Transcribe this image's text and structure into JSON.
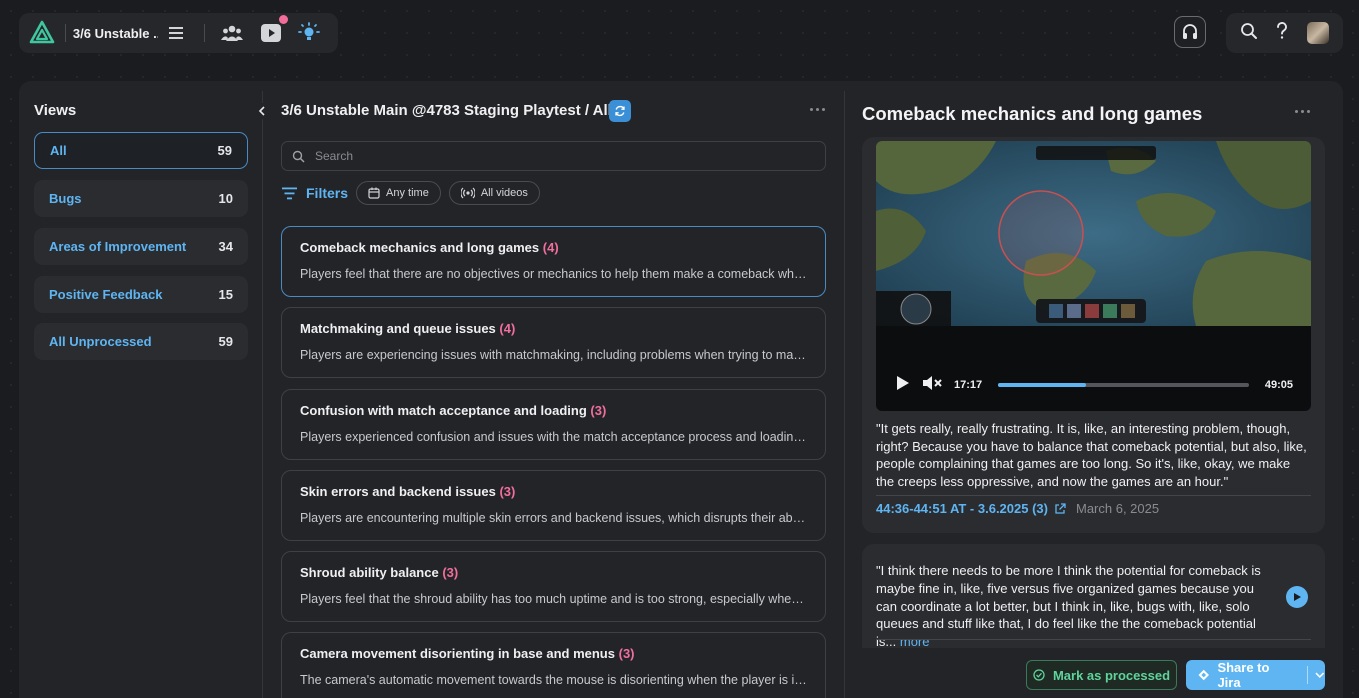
{
  "topbar": {
    "project_name": "3/6 Unstable ...",
    "has_notification_dot": true
  },
  "views": {
    "title": "Views",
    "items": [
      {
        "label": "All",
        "count": "59",
        "active": true
      },
      {
        "label": "Bugs",
        "count": "10"
      },
      {
        "label": "Areas of Improvement",
        "count": "34"
      },
      {
        "label": "Positive Feedback",
        "count": "15"
      },
      {
        "label": "All Unprocessed",
        "count": "59"
      }
    ]
  },
  "middle": {
    "title": "3/6 Unstable Main @4783 Staging Playtest / All",
    "search_placeholder": "Search",
    "filters_label": "Filters",
    "chips": [
      {
        "label": "Any time",
        "icon": "calendar-icon"
      },
      {
        "label": "All videos",
        "icon": "broadcast-icon"
      }
    ],
    "cards": [
      {
        "title": "Comeback mechanics and long games",
        "count": "(4)",
        "desc": "Players feel that there are no objectives or mechanics to help them make a comeback when they are behind.",
        "active": true
      },
      {
        "title": "Matchmaking and queue issues",
        "count": "(4)",
        "desc": "Players are experiencing issues with matchmaking, including problems when trying to match with friends."
      },
      {
        "title": "Confusion with match acceptance and loading",
        "count": "(3)",
        "desc": "Players experienced confusion and issues with the match acceptance process and loading screens."
      },
      {
        "title": "Skin errors and backend issues",
        "count": "(3)",
        "desc": "Players are encountering multiple skin errors and backend issues, which disrupts their ability to play."
      },
      {
        "title": "Shroud ability balance",
        "count": "(3)",
        "desc": "Players feel that the shroud ability has too much uptime and is too strong, especially when combined."
      },
      {
        "title": "Camera movement disorienting in base and menus",
        "count": "(3)",
        "desc": "The camera's automatic movement towards the mouse is disorienting when the player is in the base."
      }
    ]
  },
  "detail": {
    "title": "Comeback mechanics and long games",
    "video": {
      "current_time": "17:17",
      "duration": "49:05",
      "progress_fraction": 0.35
    },
    "quote1": "\"It gets really, really frustrating. It is, like, an interesting problem, though, right? Because you have to balance that comeback potential, but also, like, people complaining that games are too long. So it's, like, okay, we make the creeps less oppressive, and now the games are an hour.\"",
    "timestamp_link": "44:36-44:51 AT - 3.6.2025 (3)",
    "timestamp_date": "March 6, 2025",
    "quote2": "\"I think there needs to be more I think the potential for comeback is maybe fine in, like, five versus five organized games because you can coordinate a lot better, but I think in, like, bugs with, like, solo queues and stuff like that, I do feel like the the comeback potential is...",
    "more_label": "more"
  },
  "actions": {
    "mark_processed": "Mark as processed",
    "share_jira": "Share to Jira"
  },
  "colors": {
    "accent": "#5eb5f2",
    "count_pink": "#f06f9c",
    "processed_green": "#5fd39a"
  }
}
